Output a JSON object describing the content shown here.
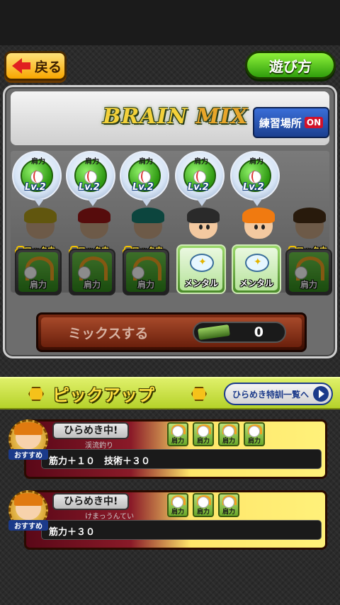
{
  "header": {
    "back_label": "戻る",
    "howto_label": "遊び方"
  },
  "brain_mix": {
    "title_part1": "BRAIN",
    "title_part2": "MIX",
    "practice_label": "練習場所",
    "practice_state": "ON",
    "lock_label": "ロック中",
    "bubbles": [
      {
        "skill": "肩力",
        "level": "Lv.2"
      },
      {
        "skill": "肩力",
        "level": "Lv.2"
      },
      {
        "skill": "肩力",
        "level": "Lv.2"
      },
      {
        "skill": "肩力",
        "level": "Lv.2"
      },
      {
        "skill": "肩力",
        "level": "Lv.2"
      }
    ],
    "cards": [
      {
        "label": "肩力",
        "locked": true
      },
      {
        "label": "肩力",
        "locked": true
      },
      {
        "label": "肩力",
        "locked": true
      },
      {
        "label": "メンタル",
        "locked": false
      },
      {
        "label": "メンタル",
        "locked": false
      },
      {
        "label": "肩力",
        "locked": true
      }
    ],
    "mix_button_label": "ミックスする",
    "mix_count": "0"
  },
  "pickup": {
    "title": "ピックアップ",
    "list_button_label": "ひらめき特訓一覧へ",
    "events": [
      {
        "badge": "ひらめき中!",
        "subtitle": "渓流釣り",
        "medal_label": "おすすめ",
        "bonus": "筋力＋１０　技術＋３０",
        "skills": [
          "肩力",
          "肩力",
          "肩力",
          "肩力"
        ]
      },
      {
        "badge": "ひらめき中!",
        "subtitle": "けまっうんてい",
        "medal_label": "おすすめ",
        "bonus": "筋力＋３０",
        "skills": [
          "肩力",
          "肩力",
          "肩力"
        ]
      }
    ]
  },
  "colors": {
    "back_button": "#f7a600",
    "howto_button": "#2f9d0c",
    "practice_button": "#1b3f8f",
    "practice_on": "#d2112a",
    "pickup_bar": "#b6d22a",
    "mix_bar": "#6a200c"
  }
}
